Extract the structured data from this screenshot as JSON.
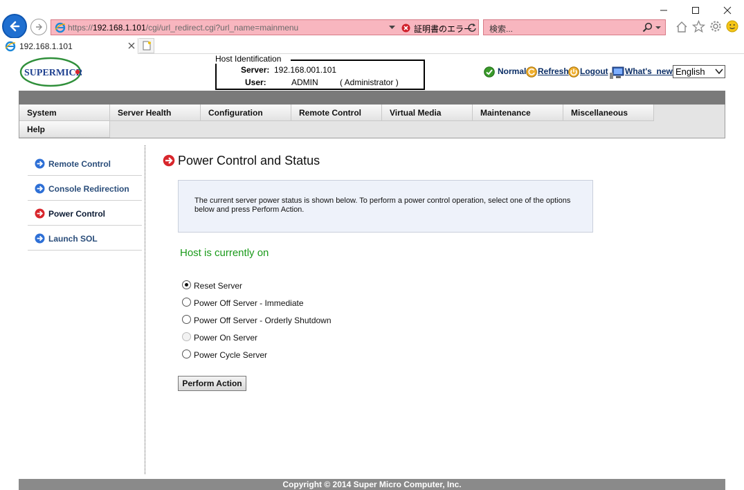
{
  "browser": {
    "address_prefix": "https://",
    "address_host": "192.168.1.101",
    "address_path": "/cgi/url_redirect.cgi?url_name=mainmenu",
    "cert_error": "証明書のエラー",
    "search_placeholder": "検索...",
    "tab_title": "192.168.1.101"
  },
  "header": {
    "logo_text": "SUPERMICR",
    "host_identification_title": "Host Identification",
    "server_label": "Server:",
    "server_value": "192.168.001.101",
    "user_label": "User:",
    "user_value": "ADMIN",
    "user_role": "( Administrator )",
    "links": {
      "normal": "Normal",
      "refresh": "Refresh",
      "logout": "Logout",
      "whats_new": "What's_new"
    },
    "language": "English"
  },
  "menu": {
    "items": [
      "System",
      "Server Health",
      "Configuration",
      "Remote Control",
      "Virtual Media",
      "Maintenance",
      "Miscellaneous"
    ],
    "help": "Help"
  },
  "sidebar": {
    "items": [
      {
        "label": "Remote Control",
        "icon": "blue-arrow-icon"
      },
      {
        "label": "Console Redirection",
        "icon": "blue-arrow-icon"
      },
      {
        "label": "Power Control",
        "icon": "red-arrow-icon",
        "active": true
      },
      {
        "label": "Launch SOL",
        "icon": "blue-arrow-icon"
      }
    ]
  },
  "main": {
    "title": "Power Control and Status",
    "info": "The current server power status is shown below. To perform a power control operation, select one of the options below and press Perform Action.",
    "status": "Host is currently on",
    "options": [
      {
        "label": "Reset Server",
        "checked": true,
        "disabled": false
      },
      {
        "label": "Power Off Server - Immediate",
        "checked": false,
        "disabled": false
      },
      {
        "label": "Power Off Server - Orderly Shutdown",
        "checked": false,
        "disabled": false
      },
      {
        "label": "Power On Server",
        "checked": false,
        "disabled": true
      },
      {
        "label": "Power Cycle Server",
        "checked": false,
        "disabled": false
      }
    ],
    "action_button": "Perform Action"
  },
  "footer": {
    "copyright": "Copyright © 2014 Super Micro Computer, Inc."
  },
  "colors": {
    "status_green": "#1a9a1a",
    "address_error_bg": "#f8b6bf",
    "menu_bar_gray": "#7a7a7a"
  }
}
